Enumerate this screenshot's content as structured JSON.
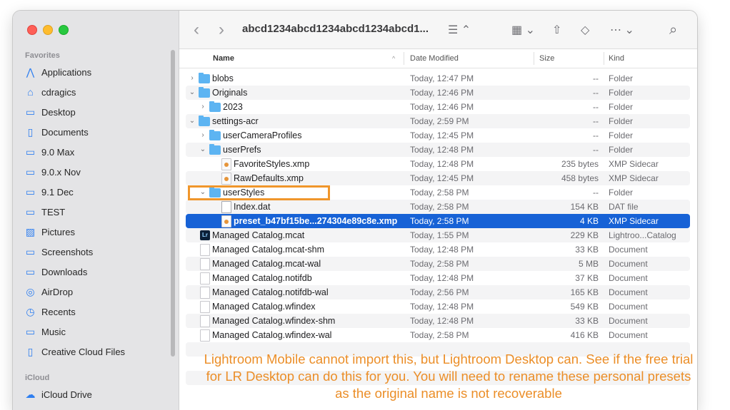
{
  "window": {
    "title": "abcd1234abcd1234abcd1234abcd1..."
  },
  "sidebar": {
    "favorites_heading": "Favorites",
    "items": [
      {
        "label": "Applications",
        "icon": "applications-icon",
        "glyph": "⋀"
      },
      {
        "label": "cdragics",
        "icon": "home-icon",
        "glyph": "⌂"
      },
      {
        "label": "Desktop",
        "icon": "desktop-icon",
        "glyph": "▭"
      },
      {
        "label": "Documents",
        "icon": "document-icon",
        "glyph": "▯"
      },
      {
        "label": "9.0 Max",
        "icon": "folder-icon",
        "glyph": "▭"
      },
      {
        "label": "9.0.x Nov",
        "icon": "folder-icon",
        "glyph": "▭"
      },
      {
        "label": "9.1 Dec",
        "icon": "folder-icon",
        "glyph": "▭"
      },
      {
        "label": "TEST",
        "icon": "folder-icon",
        "glyph": "▭"
      },
      {
        "label": "Pictures",
        "icon": "pictures-icon",
        "glyph": "▨"
      },
      {
        "label": "Screenshots",
        "icon": "folder-icon",
        "glyph": "▭"
      },
      {
        "label": "Downloads",
        "icon": "folder-icon",
        "glyph": "▭"
      },
      {
        "label": "AirDrop",
        "icon": "airdrop-icon",
        "glyph": "◎"
      },
      {
        "label": "Recents",
        "icon": "clock-icon",
        "glyph": "◷"
      },
      {
        "label": "Music",
        "icon": "folder-icon",
        "glyph": "▭"
      },
      {
        "label": "Creative Cloud Files",
        "icon": "document-icon",
        "glyph": "▯"
      }
    ],
    "icloud_heading": "iCloud",
    "icloud_items": [
      {
        "label": "iCloud Drive",
        "icon": "cloud-icon",
        "glyph": "☁"
      }
    ]
  },
  "toolbar": {
    "back_glyph": "‹",
    "forward_glyph": "›",
    "list_view_glyph": "☰ ⌃",
    "group_glyph": "▦ ⌄",
    "share_glyph": "⇧",
    "tag_glyph": "◇",
    "more_glyph": "⋯ ⌄",
    "search_glyph": "⌕"
  },
  "columns": {
    "name": "Name",
    "date": "Date Modified",
    "size": "Size",
    "kind": "Kind"
  },
  "files": [
    {
      "name": "blobs",
      "date": "Today, 12:47 PM",
      "size": "--",
      "kind": "Folder",
      "type": "folder",
      "disclosure": "›"
    },
    {
      "name": "Originals",
      "date": "Today, 12:46 PM",
      "size": "--",
      "kind": "Folder",
      "type": "folder",
      "disclosure": "⌄"
    },
    {
      "name": "2023",
      "date": "Today, 12:46 PM",
      "size": "--",
      "kind": "Folder",
      "type": "folder",
      "disclosure": "›"
    },
    {
      "name": "settings-acr",
      "date": "Today, 2:59 PM",
      "size": "--",
      "kind": "Folder",
      "type": "folder",
      "disclosure": "⌄"
    },
    {
      "name": "userCameraProfiles",
      "date": "Today, 12:45 PM",
      "size": "--",
      "kind": "Folder",
      "type": "folder",
      "disclosure": "›"
    },
    {
      "name": "userPrefs",
      "date": "Today, 12:48 PM",
      "size": "--",
      "kind": "Folder",
      "type": "folder",
      "disclosure": "⌄"
    },
    {
      "name": "FavoriteStyles.xmp",
      "date": "Today, 12:48 PM",
      "size": "235 bytes",
      "kind": "XMP Sidecar",
      "type": "xmp",
      "disclosure": ""
    },
    {
      "name": "RawDefaults.xmp",
      "date": "Today, 12:45 PM",
      "size": "458 bytes",
      "kind": "XMP Sidecar",
      "type": "xmp",
      "disclosure": ""
    },
    {
      "name": "userStyles",
      "date": "Today, 2:58 PM",
      "size": "--",
      "kind": "Folder",
      "type": "folder",
      "disclosure": "⌄"
    },
    {
      "name": "Index.dat",
      "date": "Today, 2:58 PM",
      "size": "154 KB",
      "kind": "DAT file",
      "type": "dat",
      "disclosure": ""
    },
    {
      "name": "preset_b47bf15be...274304e89c8e.xmp",
      "date": "Today, 2:58 PM",
      "size": "4 KB",
      "kind": "XMP Sidecar",
      "type": "xmp",
      "disclosure": ""
    },
    {
      "name": "Managed Catalog.mcat",
      "date": "Today, 1:55 PM",
      "size": "229 KB",
      "kind": "Lightroo...Catalog",
      "type": "lr",
      "disclosure": ""
    },
    {
      "name": "Managed Catalog.mcat-shm",
      "date": "Today, 12:48 PM",
      "size": "33 KB",
      "kind": "Document",
      "type": "doc",
      "disclosure": ""
    },
    {
      "name": "Managed Catalog.mcat-wal",
      "date": "Today, 2:58 PM",
      "size": "5 MB",
      "kind": "Document",
      "type": "doc",
      "disclosure": ""
    },
    {
      "name": "Managed Catalog.notifdb",
      "date": "Today, 12:48 PM",
      "size": "37 KB",
      "kind": "Document",
      "type": "doc",
      "disclosure": ""
    },
    {
      "name": "Managed Catalog.notifdb-wal",
      "date": "Today, 2:56 PM",
      "size": "165 KB",
      "kind": "Document",
      "type": "doc",
      "disclosure": ""
    },
    {
      "name": "Managed Catalog.wfindex",
      "date": "Today, 12:48 PM",
      "size": "549 KB",
      "kind": "Document",
      "type": "doc",
      "disclosure": ""
    },
    {
      "name": "Managed Catalog.wfindex-shm",
      "date": "Today, 12:48 PM",
      "size": "33 KB",
      "kind": "Document",
      "type": "doc",
      "disclosure": ""
    },
    {
      "name": "Managed Catalog.wfindex-wal",
      "date": "Today, 2:58 PM",
      "size": "416 KB",
      "kind": "Document",
      "type": "doc",
      "disclosure": ""
    }
  ],
  "annotation": {
    "text": "Lightroom Mobile cannot import this, but Lightroom Desktop can.  See if the free trial for LR Desktop can do this for you.  You will need to rename these personal presets as the original name is not recoverable",
    "color": "#eb8e28"
  },
  "selected_color": "#1762d6"
}
